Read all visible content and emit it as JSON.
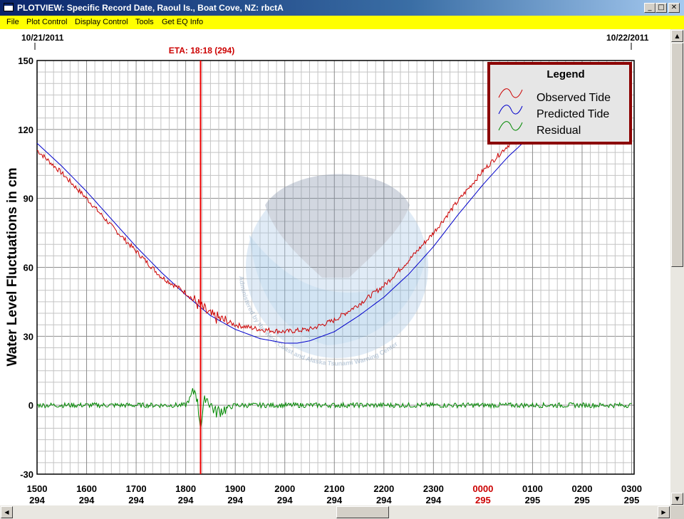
{
  "window": {
    "title": "PLOTVIEW: Specific Record Date, Raoul Is., Boat Cove, NZ: rbctA",
    "minimize": "_",
    "maximize": "□",
    "close": "✕"
  },
  "menu": [
    "File",
    "Plot Control",
    "Display Control",
    "Tools",
    "Get EQ Info"
  ],
  "plot": {
    "date_left": "10/21/2011",
    "date_right": "10/22/2011",
    "eta_label": "ETA: 18:18 (294)",
    "ylabel": "Water Level Fluctuations in cm",
    "watermark_text": "Administered by the West Coast and Alaska Tsunami Warning Center",
    "legend": {
      "title": "Legend",
      "items": [
        {
          "label": "Observed Tide",
          "color": "#cc0000"
        },
        {
          "label": "Predicted Tide",
          "color": "#0000cc"
        },
        {
          "label": "Residual",
          "color": "#008800"
        }
      ]
    }
  },
  "chart_data": {
    "type": "line",
    "title": "",
    "ylabel": "Water Level Fluctuations in cm",
    "ylim": [
      -30,
      150
    ],
    "yticks": [
      -30,
      0,
      30,
      60,
      90,
      120,
      150
    ],
    "xlim_hours": [
      15.0,
      27.05
    ],
    "xtick_labels": [
      {
        "time": "1500",
        "day": "294",
        "highlight": false
      },
      {
        "time": "1600",
        "day": "294",
        "highlight": false
      },
      {
        "time": "1700",
        "day": "294",
        "highlight": false
      },
      {
        "time": "1800",
        "day": "294",
        "highlight": false
      },
      {
        "time": "1900",
        "day": "294",
        "highlight": false
      },
      {
        "time": "2000",
        "day": "294",
        "highlight": false
      },
      {
        "time": "2100",
        "day": "294",
        "highlight": false
      },
      {
        "time": "2200",
        "day": "294",
        "highlight": false
      },
      {
        "time": "2300",
        "day": "294",
        "highlight": false
      },
      {
        "time": "0000",
        "day": "295",
        "highlight": true
      },
      {
        "time": "0100",
        "day": "295",
        "highlight": false
      },
      {
        "time": "0200",
        "day": "295",
        "highlight": false
      },
      {
        "time": "0300",
        "day": "295",
        "highlight": false
      }
    ],
    "eta_hour": 18.3,
    "grid": true,
    "legend_position": "top-right",
    "colors": {
      "observed": "#cc0000",
      "predicted": "#0000cc",
      "residual": "#008800",
      "eta": "#ee0000",
      "highlight_tick": "#cc0000"
    },
    "series": [
      {
        "name": "Predicted Tide",
        "x": [
          15.0,
          15.5,
          16.0,
          16.5,
          17.0,
          17.5,
          18.0,
          18.5,
          19.0,
          19.5,
          20.0,
          20.25,
          20.5,
          21.0,
          21.5,
          22.0,
          22.5,
          23.0,
          23.5,
          24.0,
          24.5,
          25.0,
          25.5,
          26.0,
          26.5,
          27.0
        ],
        "y": [
          114,
          104,
          93,
          81,
          69,
          58,
          48,
          39,
          33,
          29,
          27,
          27,
          28,
          32,
          39,
          47,
          57,
          69,
          83,
          96,
          108,
          118,
          125,
          128,
          125,
          120
        ]
      },
      {
        "name": "Observed Tide",
        "x": [
          15.0,
          15.5,
          16.0,
          16.5,
          17.0,
          17.5,
          18.0,
          18.25,
          18.5,
          19.0,
          19.5,
          20.0,
          20.5,
          21.0,
          21.5,
          22.0,
          22.5,
          23.0,
          23.5,
          24.0,
          24.5,
          25.0,
          25.5,
          26.0,
          26.5,
          27.0
        ],
        "y": [
          111,
          101,
          90,
          78,
          67,
          56,
          49,
          44,
          39,
          35,
          33,
          32,
          33,
          37,
          44,
          52,
          63,
          75,
          89,
          102,
          113,
          121,
          126,
          129,
          126,
          121
        ]
      },
      {
        "name": "Residual",
        "x": [
          15.0,
          16.0,
          17.0,
          18.0,
          18.2,
          18.3,
          18.4,
          18.6,
          19.0,
          20.0,
          21.0,
          22.0,
          23.0,
          24.0,
          25.0,
          26.0,
          27.0
        ],
        "y": [
          0,
          0,
          0,
          0,
          7,
          -9,
          4,
          -3,
          0,
          0,
          0,
          0,
          0,
          0,
          0,
          0,
          0
        ]
      }
    ]
  }
}
